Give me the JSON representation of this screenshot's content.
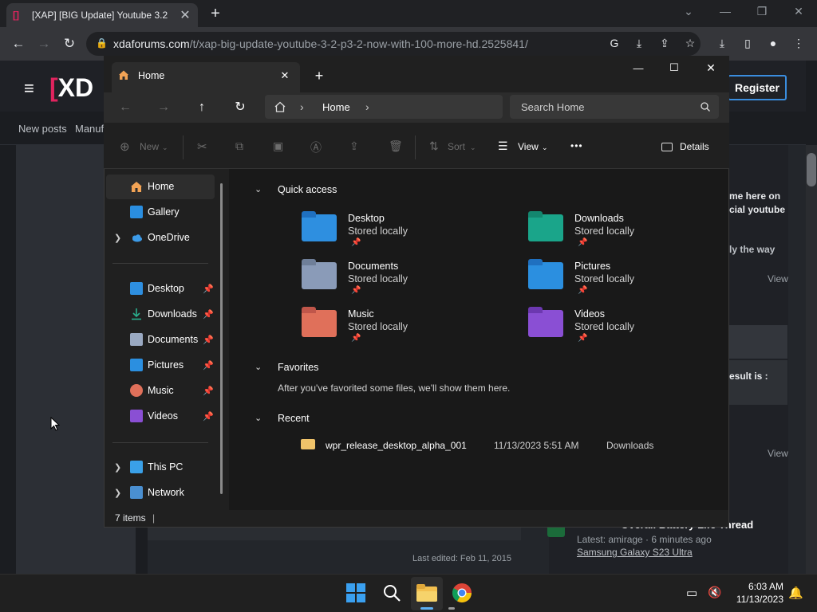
{
  "browser": {
    "tab_title": "[XAP] [BIG Update] Youtube 3.2",
    "tab_close": "✕",
    "new_tab": "+",
    "favicon": "[]",
    "url_domain": "xdaforums.com",
    "url_path": "/t/xap-big-update-youtube-3-2-p3-2-now-with-100-more-hd.2525841/",
    "back": "←",
    "forward": "→",
    "reload": "↻",
    "lock": "🔒",
    "win_controls": [
      "⌄",
      "—",
      "❐",
      "✕"
    ],
    "toolbar_icons": [
      "G",
      "⤓",
      "⇪",
      "☆",
      "⤓",
      "▯",
      "●",
      "⋮"
    ]
  },
  "site": {
    "logo_text": "XD",
    "register_label": "Register",
    "nav": [
      "New posts",
      "Manuf"
    ],
    "right_texts": [
      "me here on",
      "cial youtube",
      "ly the way",
      "View",
      "esult is :",
      "View"
    ],
    "latest_title": "Samsung Galaxy S23 Ultra",
    "latest_meta": "Latest: amirage · 6 minutes ago",
    "latest_header": "Overall Battery Life Thread",
    "last_edited": "Last edited: Feb 11, 2015"
  },
  "explorer": {
    "tab_label": "Home",
    "tab_close": "✕",
    "new_tab": "+",
    "win_controls": [
      "—",
      "☐",
      "✕"
    ],
    "address": "Home",
    "address_sep": "›",
    "search_placeholder": "Search Home",
    "commands": {
      "new": "New",
      "sort": "Sort",
      "view": "View",
      "more": "•••",
      "details": "Details"
    },
    "sidebar": {
      "top": [
        "Home",
        "Gallery",
        "OneDrive"
      ],
      "pinned": [
        "Desktop",
        "Downloads",
        "Documents",
        "Pictures",
        "Music",
        "Videos"
      ],
      "bottom": [
        "This PC",
        "Network"
      ],
      "pin_glyph": "📌"
    },
    "sections": {
      "quick_access": "Quick access",
      "favorites": "Favorites",
      "favorites_empty": "After you've favorited some files, we'll show them here.",
      "recent": "Recent"
    },
    "quick_access": [
      {
        "name": "Desktop",
        "sub": "Stored locally",
        "color": "#2e8fe0"
      },
      {
        "name": "Downloads",
        "sub": "Stored locally",
        "color": "#1aa58a"
      },
      {
        "name": "Documents",
        "sub": "Stored locally",
        "color": "#8a9bb8"
      },
      {
        "name": "Pictures",
        "sub": "Stored locally",
        "color": "#2b8fe0"
      },
      {
        "name": "Music",
        "sub": "Stored locally",
        "color": "#e0705a"
      },
      {
        "name": "Videos",
        "sub": "Stored locally",
        "color": "#8a4fd4"
      }
    ],
    "recent": [
      {
        "name": "wpr_release_desktop_alpha_001",
        "date": "11/13/2023 5:51 AM",
        "location": "Downloads"
      }
    ],
    "status": "7 items"
  },
  "taskbar": {
    "time": "6:03 AM",
    "date": "11/13/2023"
  }
}
